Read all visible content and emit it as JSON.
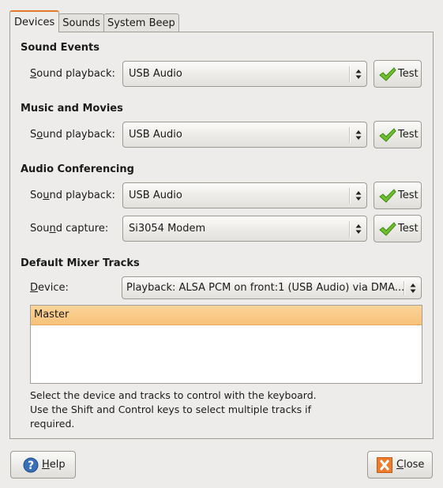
{
  "tabs": [
    {
      "label": "Devices",
      "active": true
    },
    {
      "label": "Sounds",
      "active": false
    },
    {
      "label": "System Beep",
      "active": false
    }
  ],
  "sections": {
    "sound_events": {
      "title": "Sound Events",
      "rows": [
        {
          "label_pre": "",
          "label_u": "S",
          "label_post": "ound playback:",
          "value": "USB Audio",
          "button": "Test"
        }
      ]
    },
    "music_movies": {
      "title": "Music and Movies",
      "rows": [
        {
          "label_pre": "S",
          "label_u": "o",
          "label_post": "und playback:",
          "value": "USB Audio",
          "button": "Test"
        }
      ]
    },
    "audio_conferencing": {
      "title": "Audio Conferencing",
      "rows": [
        {
          "label_pre": "So",
          "label_u": "u",
          "label_post": "nd playback:",
          "value": "USB Audio",
          "button": "Test"
        },
        {
          "label_pre": "Sou",
          "label_u": "n",
          "label_post": "d capture:",
          "value": "Si3054 Modem",
          "button": "Test"
        }
      ]
    },
    "mixer": {
      "title": "Default Mixer Tracks",
      "device_label_u": "D",
      "device_label_post": "evice:",
      "device_value": "Playback: ALSA PCM on front:1 (USB Audio) via DMA...",
      "tracks": [
        "Master"
      ],
      "hint": "Select the device and tracks to control with the keyboard.\nUse the Shift and Control keys to select multiple tracks if\nrequired."
    }
  },
  "buttons": {
    "help_u": "H",
    "help_post": "elp",
    "close_u": "C",
    "close_post": "lose"
  },
  "colors": {
    "active_tab_accent": "#e07a2a",
    "selection": "#f8c27a"
  }
}
